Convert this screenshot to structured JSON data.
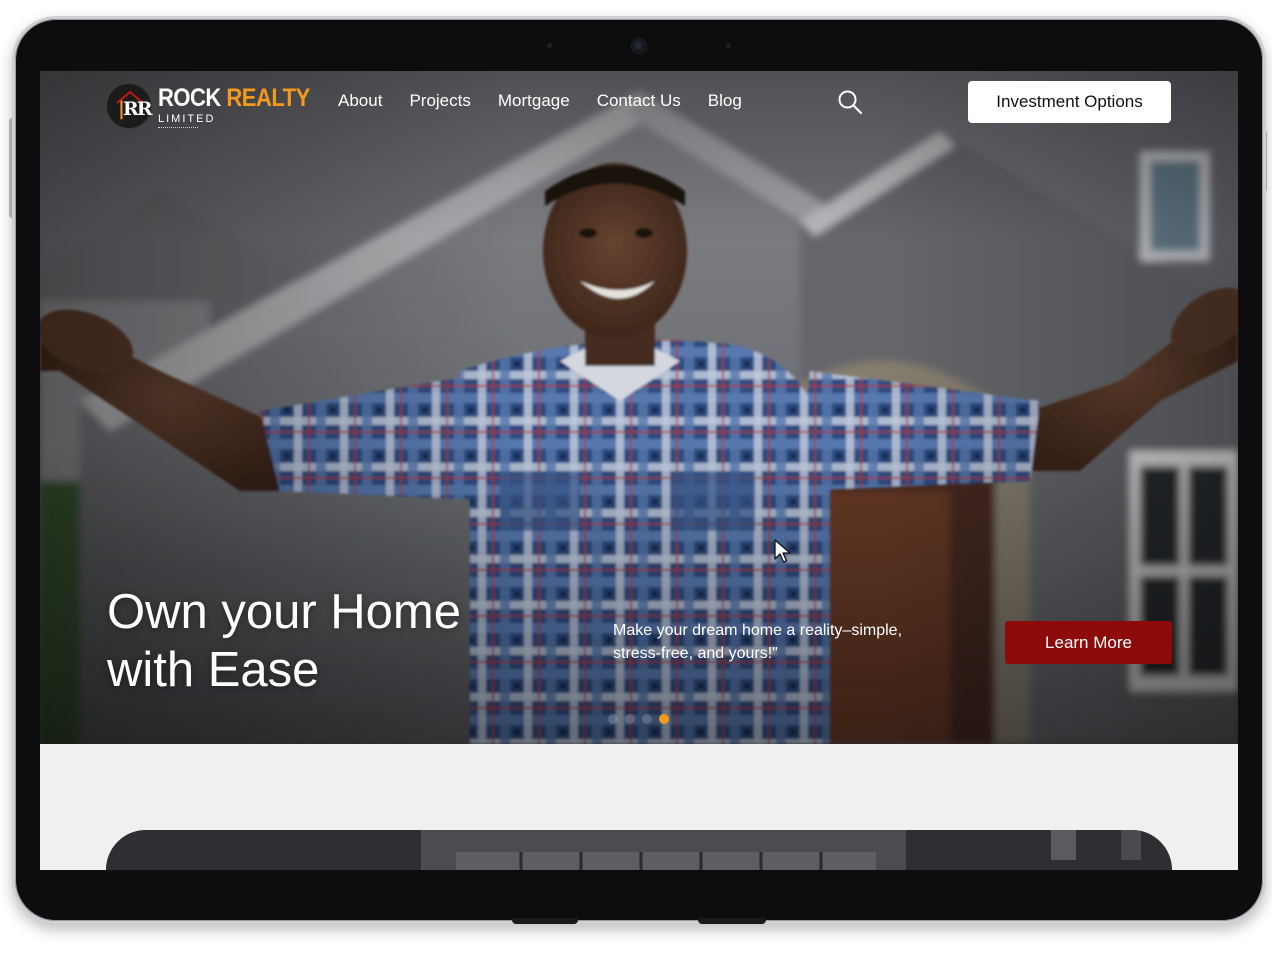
{
  "brand": {
    "logo_initials": "R",
    "name_part1": "ROCK",
    "name_part2": "REALTY",
    "subtitle": "LIMITED",
    "accent_color": "#f39a1c"
  },
  "nav": {
    "items": [
      {
        "label": "About"
      },
      {
        "label": "Projects"
      },
      {
        "label": "Mortgage"
      },
      {
        "label": "Contact Us"
      },
      {
        "label": "Blog"
      }
    ],
    "search_icon": "search-icon",
    "cta_label": "Investment Options"
  },
  "hero": {
    "title_line1": "Own your Home",
    "title_line2": "with Ease",
    "subtitle": "Make your dream home a reality–simple, stress-free, and yours!\"",
    "button_label": "Learn More",
    "button_color": "#8e0b0b",
    "slides_total": 4,
    "slide_active": 4
  }
}
